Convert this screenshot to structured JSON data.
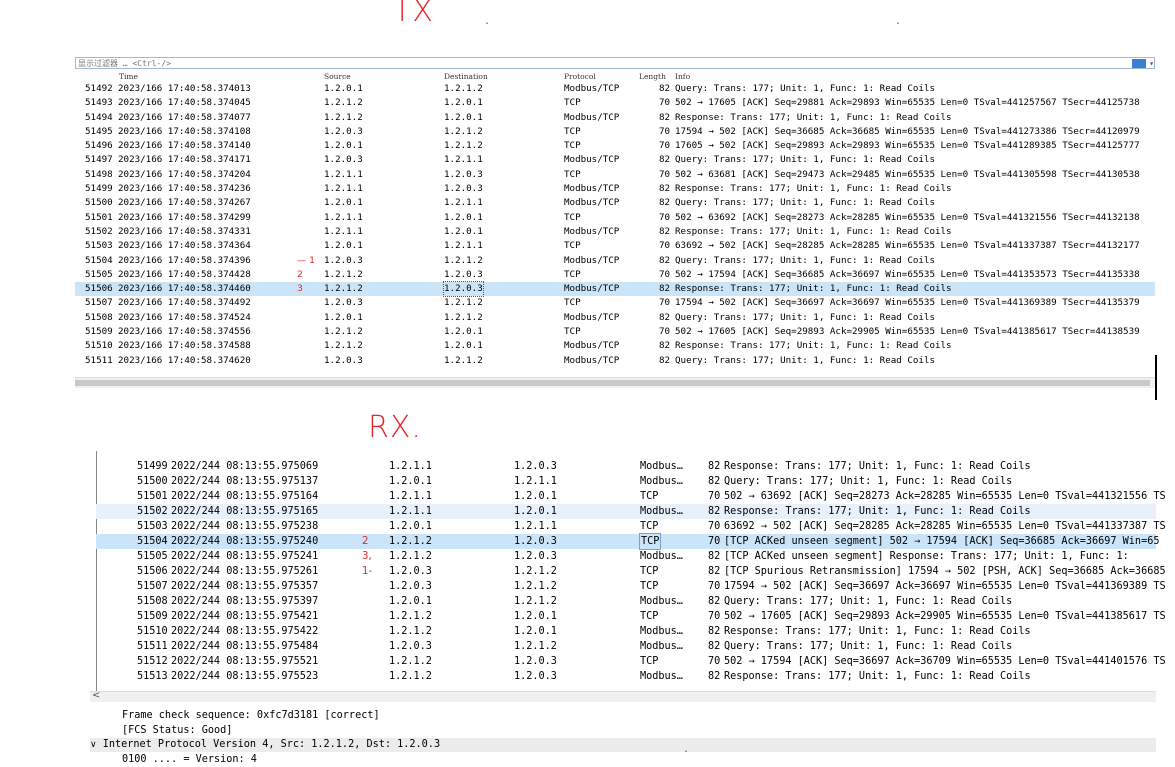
{
  "annotations": {
    "tx_label": "TX",
    "rx_label": "RX."
  },
  "tx_panel": {
    "filter_placeholder": "显示过滤器 … <Ctrl-/>",
    "columns": [
      "Time",
      "Source",
      "Destination",
      "Protocol",
      "Length",
      "Info"
    ],
    "rows": [
      {
        "no": "51492",
        "time": "2023/166 17:40:58.374013",
        "src": "1.2.0.1",
        "dst": "1.2.1.2",
        "proto": "Modbus/TCP",
        "len": "82",
        "info": "  Query: Trans:   177; Unit:   1, Func:   1: Read Coils"
      },
      {
        "no": "51493",
        "time": "2023/166 17:40:58.374045",
        "src": "1.2.1.2",
        "dst": "1.2.0.1",
        "proto": "TCP",
        "len": "70",
        "info": "502 → 17605 [ACK] Seq=29881 Ack=29893 Win=65535 Len=0 TSval=441257567 TSecr=44125738"
      },
      {
        "no": "51494",
        "time": "2023/166 17:40:58.374077",
        "src": "1.2.1.2",
        "dst": "1.2.0.1",
        "proto": "Modbus/TCP",
        "len": "82",
        "info": "Response: Trans:   177; Unit:   1, Func:   1: Read Coils"
      },
      {
        "no": "51495",
        "time": "2023/166 17:40:58.374108",
        "src": "1.2.0.3",
        "dst": "1.2.1.2",
        "proto": "TCP",
        "len": "70",
        "info": "17594 → 502 [ACK] Seq=36685 Ack=36685 Win=65535 Len=0 TSval=441273386 TSecr=44120979"
      },
      {
        "no": "51496",
        "time": "2023/166 17:40:58.374140",
        "src": "1.2.0.1",
        "dst": "1.2.1.2",
        "proto": "TCP",
        "len": "70",
        "info": "17605 → 502 [ACK] Seq=29893 Ack=29893 Win=65535 Len=0 TSval=441289385 TSecr=44125777"
      },
      {
        "no": "51497",
        "time": "2023/166 17:40:58.374171",
        "src": "1.2.0.3",
        "dst": "1.2.1.1",
        "proto": "Modbus/TCP",
        "len": "82",
        "info": "  Query: Trans:   177; Unit:   1, Func:   1: Read Coils"
      },
      {
        "no": "51498",
        "time": "2023/166 17:40:58.374204",
        "src": "1.2.1.1",
        "dst": "1.2.0.3",
        "proto": "TCP",
        "len": "70",
        "info": "502 → 63681 [ACK] Seq=29473 Ack=29485 Win=65535 Len=0 TSval=441305598 TSecr=44130538"
      },
      {
        "no": "51499",
        "time": "2023/166 17:40:58.374236",
        "src": "1.2.1.1",
        "dst": "1.2.0.3",
        "proto": "Modbus/TCP",
        "len": "82",
        "info": "Response: Trans:   177; Unit:   1, Func:   1: Read Coils"
      },
      {
        "no": "51500",
        "time": "2023/166 17:40:58.374267",
        "src": "1.2.0.1",
        "dst": "1.2.1.1",
        "proto": "Modbus/TCP",
        "len": "82",
        "info": "  Query: Trans:   177; Unit:   1, Func:   1: Read Coils"
      },
      {
        "no": "51501",
        "time": "2023/166 17:40:58.374299",
        "src": "1.2.1.1",
        "dst": "1.2.0.1",
        "proto": "TCP",
        "len": "70",
        "info": "502 → 63692 [ACK] Seq=28273 Ack=28285 Win=65535 Len=0 TSval=441321556 TSecr=44132138"
      },
      {
        "no": "51502",
        "time": "2023/166 17:40:58.374331",
        "src": "1.2.1.1",
        "dst": "1.2.0.1",
        "proto": "Modbus/TCP",
        "len": "82",
        "info": "Response: Trans:   177; Unit:   1, Func:   1: Read Coils"
      },
      {
        "no": "51503",
        "time": "2023/166 17:40:58.374364",
        "src": "1.2.0.1",
        "dst": "1.2.1.1",
        "proto": "TCP",
        "len": "70",
        "info": "63692 → 502 [ACK] Seq=28285 Ack=28285 Win=65535 Len=0 TSval=441337387 TSecr=44132177"
      },
      {
        "no": "51504",
        "time": "2023/166 17:40:58.374396",
        "src": "1.2.0.3",
        "dst": "1.2.1.2",
        "proto": "Modbus/TCP",
        "len": "82",
        "info": "  Query: Trans:   177; Unit:   1, Func:   1: Read Coils",
        "mark": "— 1"
      },
      {
        "no": "51505",
        "time": "2023/166 17:40:58.374428",
        "src": "1.2.1.2",
        "dst": "1.2.0.3",
        "proto": "TCP",
        "len": "70",
        "info": "502 → 17594 [ACK] Seq=36685 Ack=36697 Win=65535 Len=0 TSval=441353573 TSecr=44135338",
        "mark": "2"
      },
      {
        "no": "51506",
        "time": "2023/166 17:40:58.374460",
        "src": "1.2.1.2",
        "dst": "1.2.0.3",
        "proto": "Modbus/TCP",
        "len": "82",
        "info": "Response: Trans:   177; Unit:   1, Func:   1: Read Coils",
        "mark": "3"
      },
      {
        "no": "51507",
        "time": "2023/166 17:40:58.374492",
        "src": "1.2.0.3",
        "dst": "1.2.1.2",
        "proto": "TCP",
        "len": "70",
        "info": "17594 → 502 [ACK] Seq=36697 Ack=36697 Win=65535 Len=0 TSval=441369389 TSecr=44135379"
      },
      {
        "no": "51508",
        "time": "2023/166 17:40:58.374524",
        "src": "1.2.0.1",
        "dst": "1.2.1.2",
        "proto": "Modbus/TCP",
        "len": "82",
        "info": "  Query: Trans:   177; Unit:   1, Func:   1: Read Coils"
      },
      {
        "no": "51509",
        "time": "2023/166 17:40:58.374556",
        "src": "1.2.1.2",
        "dst": "1.2.0.1",
        "proto": "TCP",
        "len": "70",
        "info": "502 → 17605 [ACK] Seq=29893 Ack=29905 Win=65535 Len=0 TSval=441385617 TSecr=44138539"
      },
      {
        "no": "51510",
        "time": "2023/166 17:40:58.374588",
        "src": "1.2.1.2",
        "dst": "1.2.0.1",
        "proto": "Modbus/TCP",
        "len": "82",
        "info": "Response: Trans:   177; Unit:   1, Func:   1: Read Coils"
      },
      {
        "no": "51511",
        "time": "2023/166 17:40:58.374620",
        "src": "1.2.0.3",
        "dst": "1.2.1.2",
        "proto": "Modbus/TCP",
        "len": "82",
        "info": "  Query: Trans:   177; Unit:   1, Func:   1: Read Coils"
      }
    ]
  },
  "rx_panel": {
    "rows": [
      {
        "no": "51499",
        "time": "2022/244 08:13:55.975069",
        "src": "1.2.1.1",
        "dst": "1.2.0.3",
        "proto": "Modbus…",
        "len": "82",
        "info": "Response: Trans:   177; Unit:   1, Func:   1: Read Coils"
      },
      {
        "no": "51500",
        "time": "2022/244 08:13:55.975137",
        "src": "1.2.0.1",
        "dst": "1.2.1.1",
        "proto": "Modbus…",
        "len": "82",
        "info": "  Query: Trans:   177; Unit:   1, Func:   1: Read Coils"
      },
      {
        "no": "51501",
        "time": "2022/244 08:13:55.975164",
        "src": "1.2.1.1",
        "dst": "1.2.0.1",
        "proto": "TCP",
        "len": "70",
        "info": "502 → 63692 [ACK] Seq=28273 Ack=28285 Win=65535 Len=0 TSval=441321556 TS"
      },
      {
        "no": "51502",
        "time": "2022/244 08:13:55.975165",
        "src": "1.2.1.1",
        "dst": "1.2.0.1",
        "proto": "Modbus…",
        "len": "82",
        "info": "Response: Trans:   177; Unit:   1, Func:   1: Read Coils"
      },
      {
        "no": "51503",
        "time": "2022/244 08:13:55.975238",
        "src": "1.2.0.1",
        "dst": "1.2.1.1",
        "proto": "TCP",
        "len": "70",
        "info": "63692 → 502 [ACK] Seq=28285 Ack=28285 Win=65535 Len=0 TSval=441337387 TS"
      },
      {
        "no": "51504",
        "time": "2022/244 08:13:55.975240",
        "src": "1.2.1.2",
        "dst": "1.2.0.3",
        "proto": "TCP",
        "len": "70",
        "info": "[TCP ACKed unseen segment] 502 → 17594 [ACK] Seq=36685 Ack=36697 Win=65",
        "mark": "2"
      },
      {
        "no": "51505",
        "time": "2022/244 08:13:55.975241",
        "src": "1.2.1.2",
        "dst": "1.2.0.3",
        "proto": "Modbus…",
        "len": "82",
        "info": "[TCP ACKed unseen segment] Response: Trans:   177; Unit:   1, Func:   1:",
        "mark": "3,"
      },
      {
        "no": "51506",
        "time": "2022/244 08:13:55.975261",
        "src": "1.2.0.3",
        "dst": "1.2.1.2",
        "proto": "TCP",
        "len": "82",
        "info": "[TCP Spurious Retransmission] 17594 → 502 [PSH, ACK] Seq=36685 Ack=36685",
        "mark": "1-"
      },
      {
        "no": "51507",
        "time": "2022/244 08:13:55.975357",
        "src": "1.2.0.3",
        "dst": "1.2.1.2",
        "proto": "TCP",
        "len": "70",
        "info": "17594 → 502 [ACK] Seq=36697 Ack=36697 Win=65535 Len=0 TSval=441369389 TS"
      },
      {
        "no": "51508",
        "time": "2022/244 08:13:55.975397",
        "src": "1.2.0.1",
        "dst": "1.2.1.2",
        "proto": "Modbus…",
        "len": "82",
        "info": "  Query: Trans:   177; Unit:   1, Func:   1: Read Coils"
      },
      {
        "no": "51509",
        "time": "2022/244 08:13:55.975421",
        "src": "1.2.1.2",
        "dst": "1.2.0.1",
        "proto": "TCP",
        "len": "70",
        "info": "502 → 17605 [ACK] Seq=29893 Ack=29905 Win=65535 Len=0 TSval=441385617 TS"
      },
      {
        "no": "51510",
        "time": "2022/244 08:13:55.975422",
        "src": "1.2.1.2",
        "dst": "1.2.0.1",
        "proto": "Modbus…",
        "len": "82",
        "info": "Response: Trans:   177; Unit:   1, Func:   1: Read Coils"
      },
      {
        "no": "51511",
        "time": "2022/244 08:13:55.975484",
        "src": "1.2.0.3",
        "dst": "1.2.1.2",
        "proto": "Modbus…",
        "len": "82",
        "info": "  Query: Trans:   177; Unit:   1, Func:   1: Read Coils"
      },
      {
        "no": "51512",
        "time": "2022/244 08:13:55.975521",
        "src": "1.2.1.2",
        "dst": "1.2.0.3",
        "proto": "TCP",
        "len": "70",
        "info": "502 → 17594 [ACK] Seq=36697 Ack=36709 Win=65535 Len=0 TSval=441401576 TS"
      },
      {
        "no": "51513",
        "time": "2022/244 08:13:55.975523",
        "src": "1.2.1.2",
        "dst": "1.2.0.3",
        "proto": "Modbus…",
        "len": "82",
        "info": "Response: Trans:   177; Unit:   1, Func:   1: Read Coils"
      }
    ],
    "details": {
      "frame_check": "Frame check sequence: 0xfc7d3181 [correct]",
      "fcs_status": "[FCS Status: Good]",
      "ipv4": "Internet Protocol Version 4, Src: 1.2.1.2, Dst: 1.2.0.3",
      "version": "0100 .... = Version: 4"
    }
  },
  "colors": {
    "annotation": "#e0292e",
    "selection": "#cce4f7",
    "alt_row": "#e8f0fa",
    "filter_button": "#3b7fd3"
  }
}
